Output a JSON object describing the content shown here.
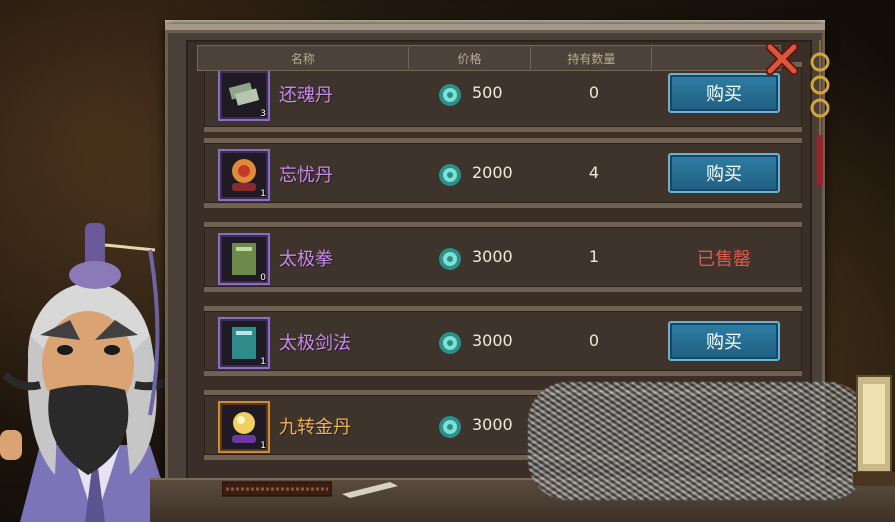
{
  "header": {
    "col_name": "名称",
    "col_price": "价格",
    "col_owned": "持有数量",
    "col_action": ""
  },
  "items": [
    {
      "name": "还魂丹",
      "icon": "spirit-notes-icon",
      "icon_count": "3",
      "price": "500",
      "owned": "0",
      "action": "购买",
      "sold_out": false
    },
    {
      "name": "忘忧丹",
      "icon": "red-orb-icon",
      "icon_count": "1",
      "price": "2000",
      "owned": "4",
      "action": "购买",
      "sold_out": false
    },
    {
      "name": "太极拳",
      "icon": "green-book-icon",
      "icon_count": "0",
      "price": "3000",
      "owned": "1",
      "action": "已售罄",
      "sold_out": true
    },
    {
      "name": "太极剑法",
      "icon": "teal-book-icon",
      "icon_count": "1",
      "price": "3000",
      "owned": "0",
      "action": "购买",
      "sold_out": false
    },
    {
      "name": "九转金丹",
      "icon": "golden-pill-icon",
      "icon_count": "1",
      "price": "3000",
      "owned": "",
      "action": "",
      "sold_out": false
    }
  ],
  "colors": {
    "purple_name": "#c78be8",
    "gold_name": "#f0b24a",
    "sold_out": "#e05a4a",
    "buy_button": "#2f7ea6"
  }
}
